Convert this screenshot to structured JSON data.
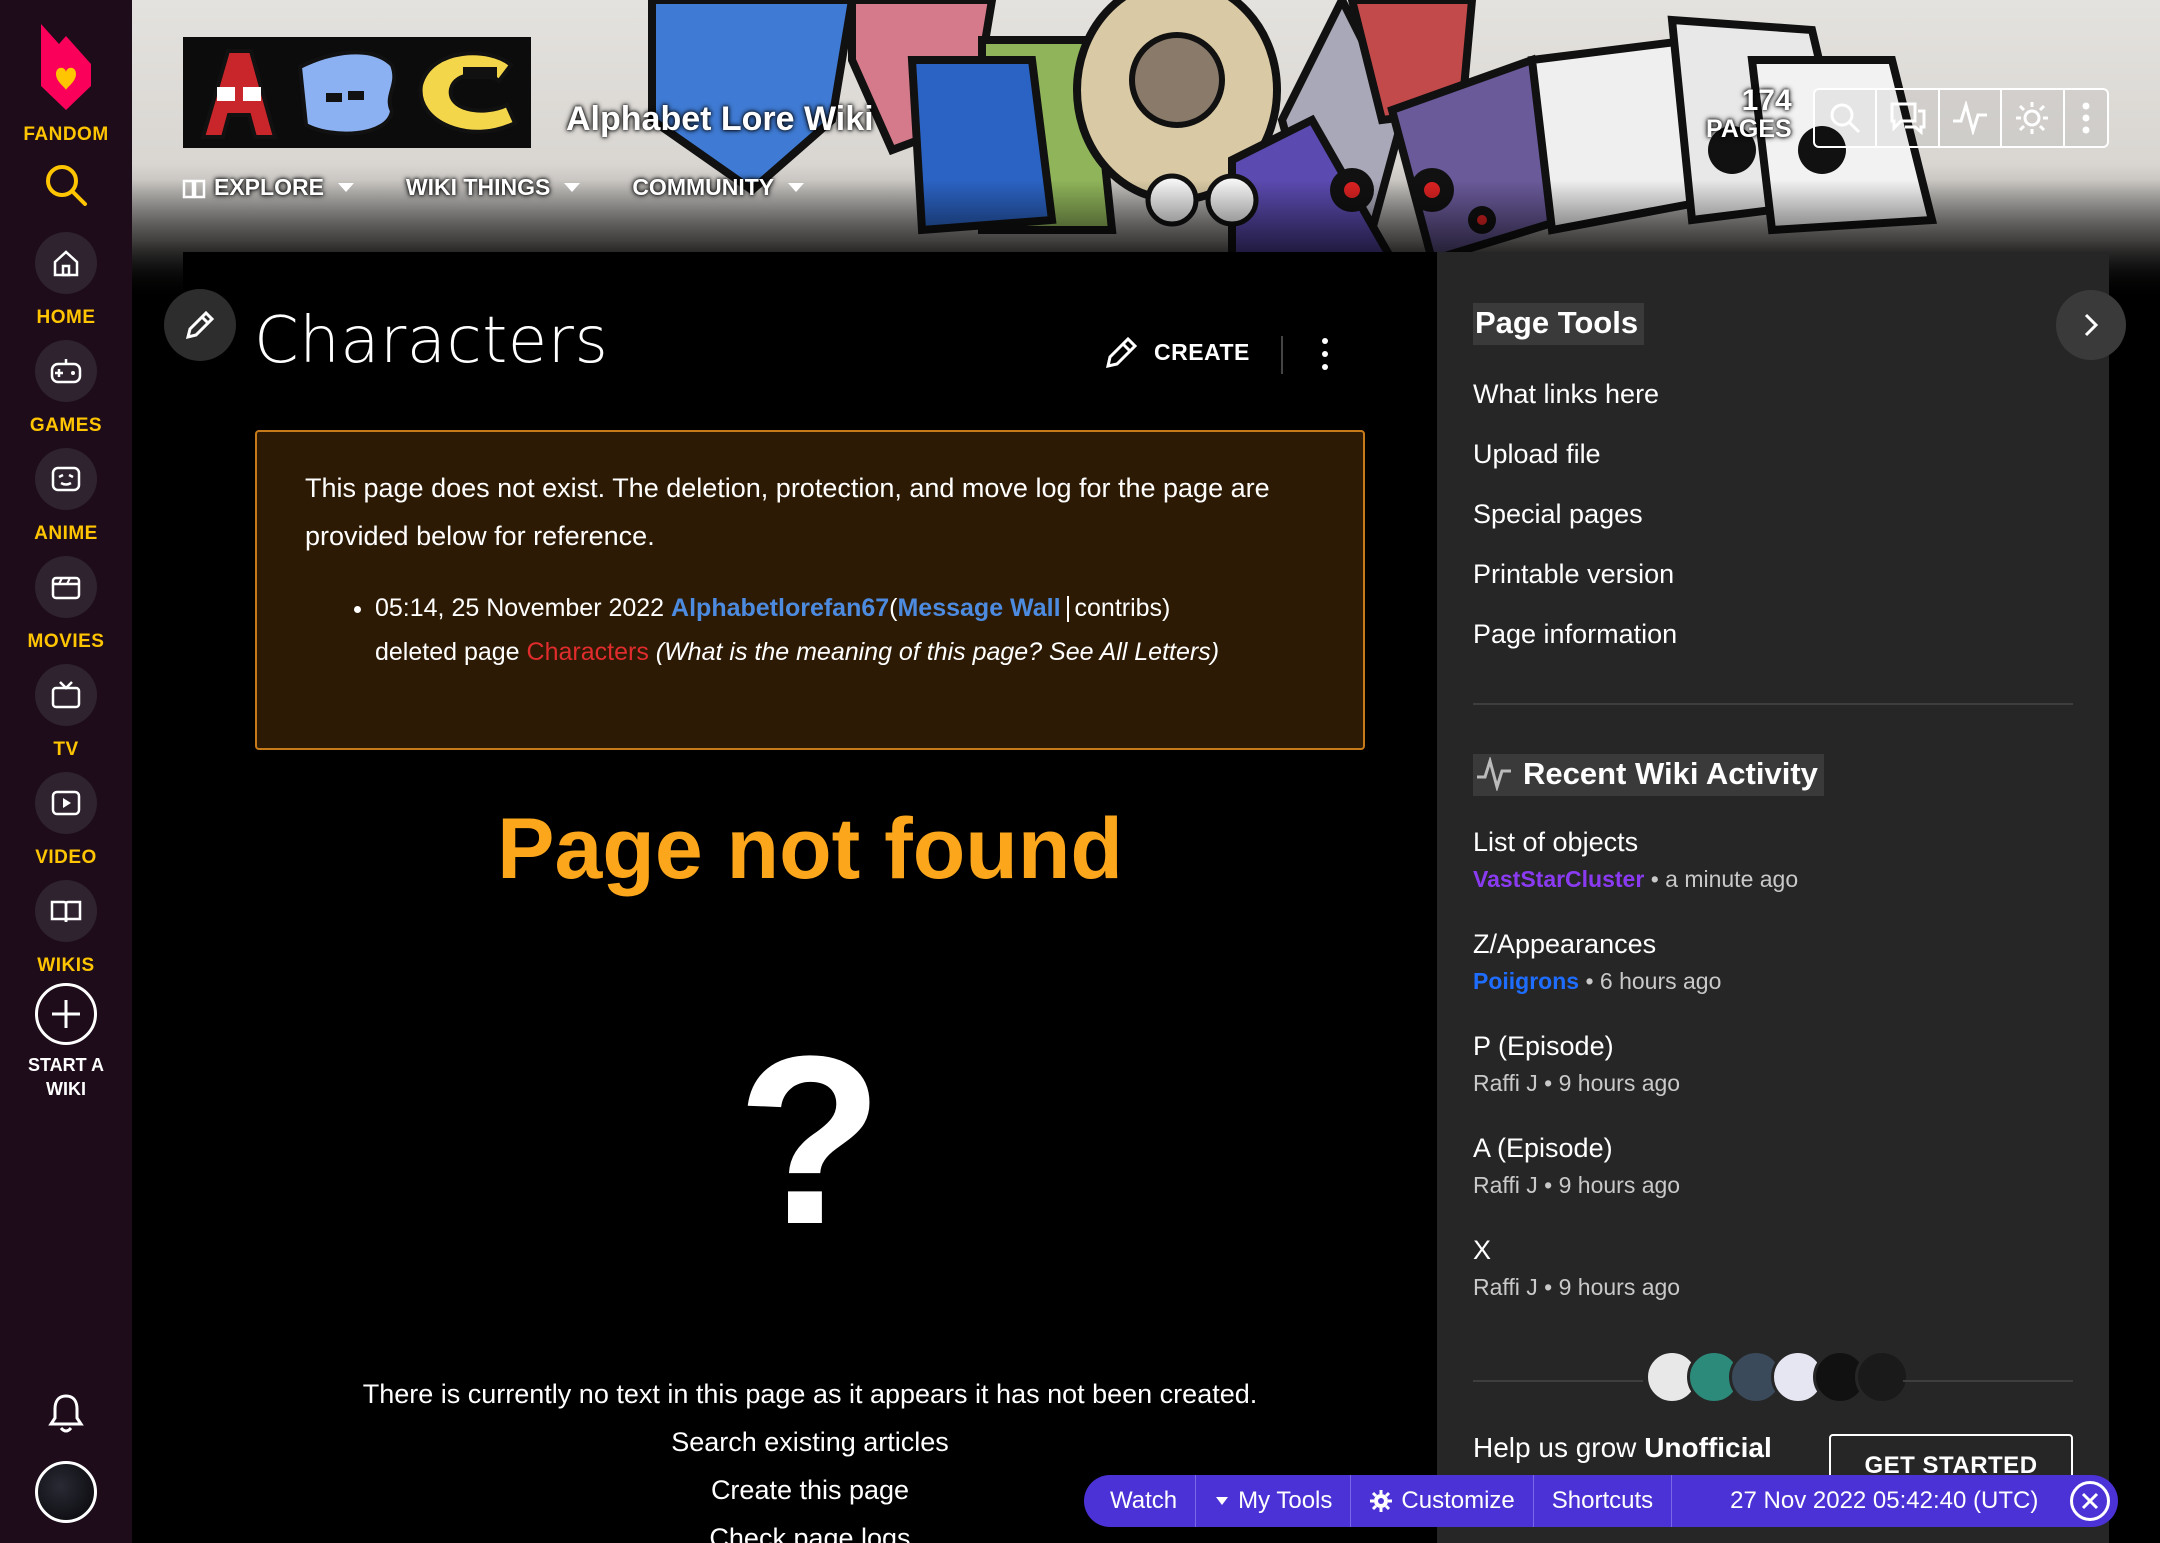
{
  "global_nav": {
    "logo_label": "FANDOM",
    "items": [
      {
        "label": "HOME",
        "icon": "home-icon"
      },
      {
        "label": "GAMES",
        "icon": "gamepad-icon"
      },
      {
        "label": "ANIME",
        "icon": "anime-icon"
      },
      {
        "label": "MOVIES",
        "icon": "clapperboard-icon"
      },
      {
        "label": "TV",
        "icon": "tv-icon"
      },
      {
        "label": "VIDEO",
        "icon": "play-icon"
      },
      {
        "label": "WIKIS",
        "icon": "book-icon"
      }
    ],
    "start_wiki_line1": "START A",
    "start_wiki_line2": "WIKI",
    "brand_color": "#ffc500"
  },
  "header": {
    "wiki_title": "Alphabet Lore Wiki",
    "nav": [
      {
        "label": "EXPLORE"
      },
      {
        "label": "WIKI THINGS"
      },
      {
        "label": "COMMUNITY"
      }
    ],
    "pages_count": "174",
    "pages_label": "PAGES"
  },
  "page": {
    "title": "Characters",
    "create_label": "CREATE",
    "notice": {
      "intro": "This page does not exist. The deletion, protection, and move log for the page are provided below for reference.",
      "log_time": "05:14, 25 November 2022",
      "log_user": "Alphabetlorefan67",
      "log_open_paren": "(",
      "log_message_wall": "Message Wall",
      "log_contribs": "contribs)",
      "log_action": "deleted page",
      "log_page": "Characters",
      "log_reason": "(What is the meaning of this page? See All Letters)"
    },
    "not_found_heading": "Page not found",
    "question_mark": "?",
    "no_text_message": "There is currently no text in this page as it appears it has not been created.",
    "links": [
      "Search existing articles",
      "Create this page",
      "Check page logs"
    ]
  },
  "rail": {
    "page_tools_heading": "Page Tools",
    "page_tools": [
      "What links here",
      "Upload file",
      "Special pages",
      "Printable version",
      "Page information"
    ],
    "activity_heading": "Recent Wiki Activity",
    "activity": [
      {
        "title": "List of objects",
        "user": "VastStarCluster",
        "time": "• a minute ago"
      },
      {
        "title": "Z/Appearances",
        "user": "Poiigrons",
        "time": "• 6 hours ago"
      },
      {
        "title": "P (Episode)",
        "user": "Raffi J",
        "time": "• 9 hours ago"
      },
      {
        "title": "A (Episode)",
        "user": "Raffi J",
        "time": "• 9 hours ago"
      },
      {
        "title": "X",
        "user": "Raffi J",
        "time": "• 9 hours ago"
      }
    ],
    "grow_text": "Help us grow",
    "grow_bold": "Unofficial",
    "get_started_label": "GET STARTED"
  },
  "bottom_toolbar": {
    "watch": "Watch",
    "my_tools": "My Tools",
    "customize": "Customize",
    "shortcuts": "Shortcuts",
    "time": "27 Nov 2022 05:42:40 (UTC)",
    "color": "#4b32d6"
  }
}
